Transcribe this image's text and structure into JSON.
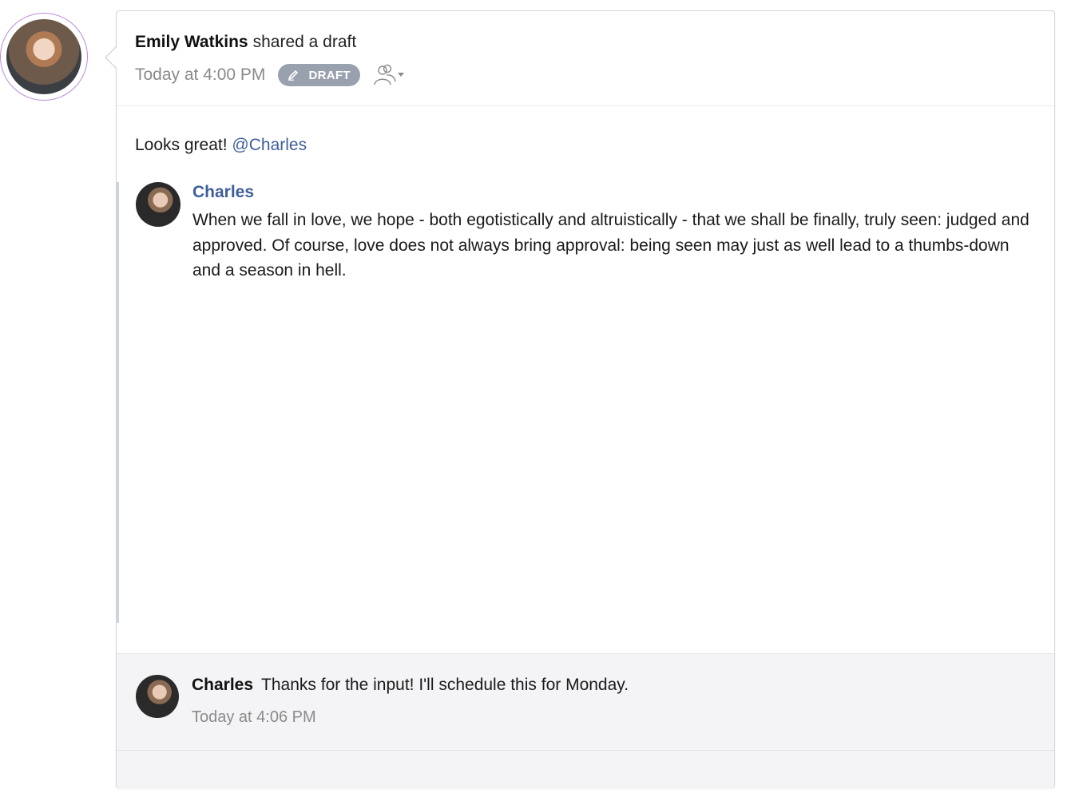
{
  "post": {
    "author_name": "Emily Watkins",
    "action_text": "shared a draft",
    "timestamp": "Today at 4:00 PM",
    "badge_label": "DRAFT",
    "badge_icon": "pencil-icon",
    "audience_icon": "people-icon",
    "body_prefix": "Looks great!",
    "mention": "@Charles"
  },
  "quote": {
    "name": "Charles",
    "text": "When we fall in love, we hope - both egotistically and altruistically - that we shall be finally, truly seen: judged and approved. Of course, love does not always bring approval: being seen may just as well lead to a thumbs-down and a season in hell."
  },
  "comment": {
    "author": "Charles",
    "text": "Thanks for the input! I'll schedule this for Monday.",
    "timestamp": "Today at 4:06 PM"
  },
  "colors": {
    "mention": "#3f5f9b",
    "badge_bg": "#9aa1ae",
    "avatar_ring": "#b98ad8",
    "comment_bg": "#f4f4f6"
  }
}
